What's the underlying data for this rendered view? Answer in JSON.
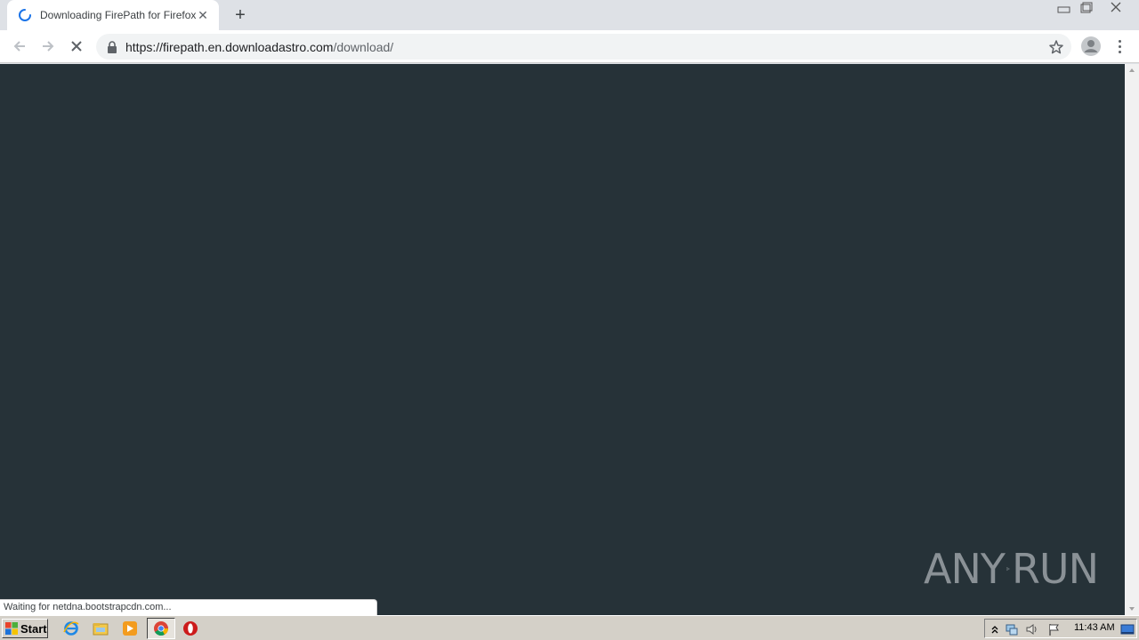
{
  "browser": {
    "tab": {
      "title": "Downloading FirePath for Firefox"
    },
    "new_tab_label": "+",
    "address": {
      "host": "https://firepath.en.downloadastro.com",
      "path": "/download/"
    },
    "status_text": "Waiting for netdna.bootstrapcdn.com..."
  },
  "page": {
    "background": "#263238"
  },
  "watermark": {
    "left": "ANY",
    "right": "RUN"
  },
  "taskbar": {
    "start_label": "Start",
    "apps": [
      "internet-explorer-icon",
      "file-explorer-icon",
      "media-player-icon",
      "chrome-icon",
      "opera-icon"
    ],
    "clock": "11:43 AM"
  }
}
